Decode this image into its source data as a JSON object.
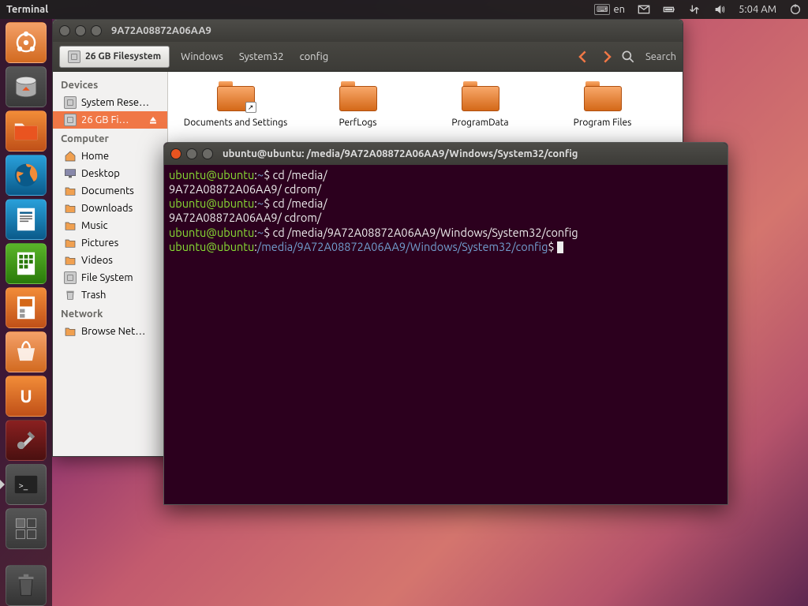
{
  "top_panel": {
    "active_app": "Terminal",
    "lang": "en",
    "time": "5:04 AM"
  },
  "launcher": {
    "items": [
      {
        "name": "dash",
        "color": "orange-soft"
      },
      {
        "name": "disk-utility",
        "color": ""
      },
      {
        "name": "files",
        "color": "orange"
      },
      {
        "name": "firefox",
        "color": "blue"
      },
      {
        "name": "writer",
        "color": "blue"
      },
      {
        "name": "calc",
        "color": "green"
      },
      {
        "name": "impress",
        "color": "orange"
      },
      {
        "name": "software-center",
        "color": "orange-soft"
      },
      {
        "name": "ubuntu-one",
        "color": "orange"
      },
      {
        "name": "settings",
        "color": "dark-red"
      },
      {
        "name": "terminal",
        "color": "",
        "active": true
      },
      {
        "name": "workspace",
        "color": ""
      }
    ]
  },
  "nautilus": {
    "title": "9A72A08872A06AA9",
    "path_button": {
      "label": "26 GB Filesystem"
    },
    "crumbs": [
      "Windows",
      "System32",
      "config"
    ],
    "search_label": "Search",
    "sidebar": {
      "devices": "Devices",
      "devices_items": [
        {
          "label": "System Rese…",
          "icon": "disk"
        },
        {
          "label": "26 GB Fi…",
          "icon": "disk",
          "selected": true,
          "eject": true
        }
      ],
      "computer": "Computer",
      "computer_items": [
        {
          "label": "Home",
          "icon": "home"
        },
        {
          "label": "Desktop",
          "icon": "desktop"
        },
        {
          "label": "Documents",
          "icon": "folder"
        },
        {
          "label": "Downloads",
          "icon": "folder"
        },
        {
          "label": "Music",
          "icon": "folder"
        },
        {
          "label": "Pictures",
          "icon": "folder"
        },
        {
          "label": "Videos",
          "icon": "folder"
        },
        {
          "label": "File System",
          "icon": "disk"
        },
        {
          "label": "Trash",
          "icon": "trash"
        }
      ],
      "network": "Network",
      "network_items": [
        {
          "label": "Browse Net…",
          "icon": "folder"
        }
      ]
    },
    "files": [
      {
        "label": "Documents and Settings",
        "shortcut": true
      },
      {
        "label": "PerfLogs"
      },
      {
        "label": "ProgramData"
      },
      {
        "label": "Program Files"
      }
    ]
  },
  "terminal": {
    "title": "ubuntu@ubuntu: /media/9A72A08872A06AA9/Windows/System32/config",
    "lines": [
      {
        "prompt": "ubuntu@ubuntu",
        "path": "~",
        "cmd": "cd /media/"
      },
      {
        "plain": "9A72A08872A06AA9/ cdrom/"
      },
      {
        "prompt": "ubuntu@ubuntu",
        "path": "~",
        "cmd": "cd /media/"
      },
      {
        "plain": "9A72A08872A06AA9/ cdrom/"
      },
      {
        "prompt": "ubuntu@ubuntu",
        "path": "~",
        "cmd": "cd /media/9A72A08872A06AA9/Windows/System32/config"
      },
      {
        "prompt": "ubuntu@ubuntu",
        "path": "/media/9A72A08872A06AA9/Windows/System32/config",
        "cmd": "",
        "cursor": true
      }
    ]
  }
}
